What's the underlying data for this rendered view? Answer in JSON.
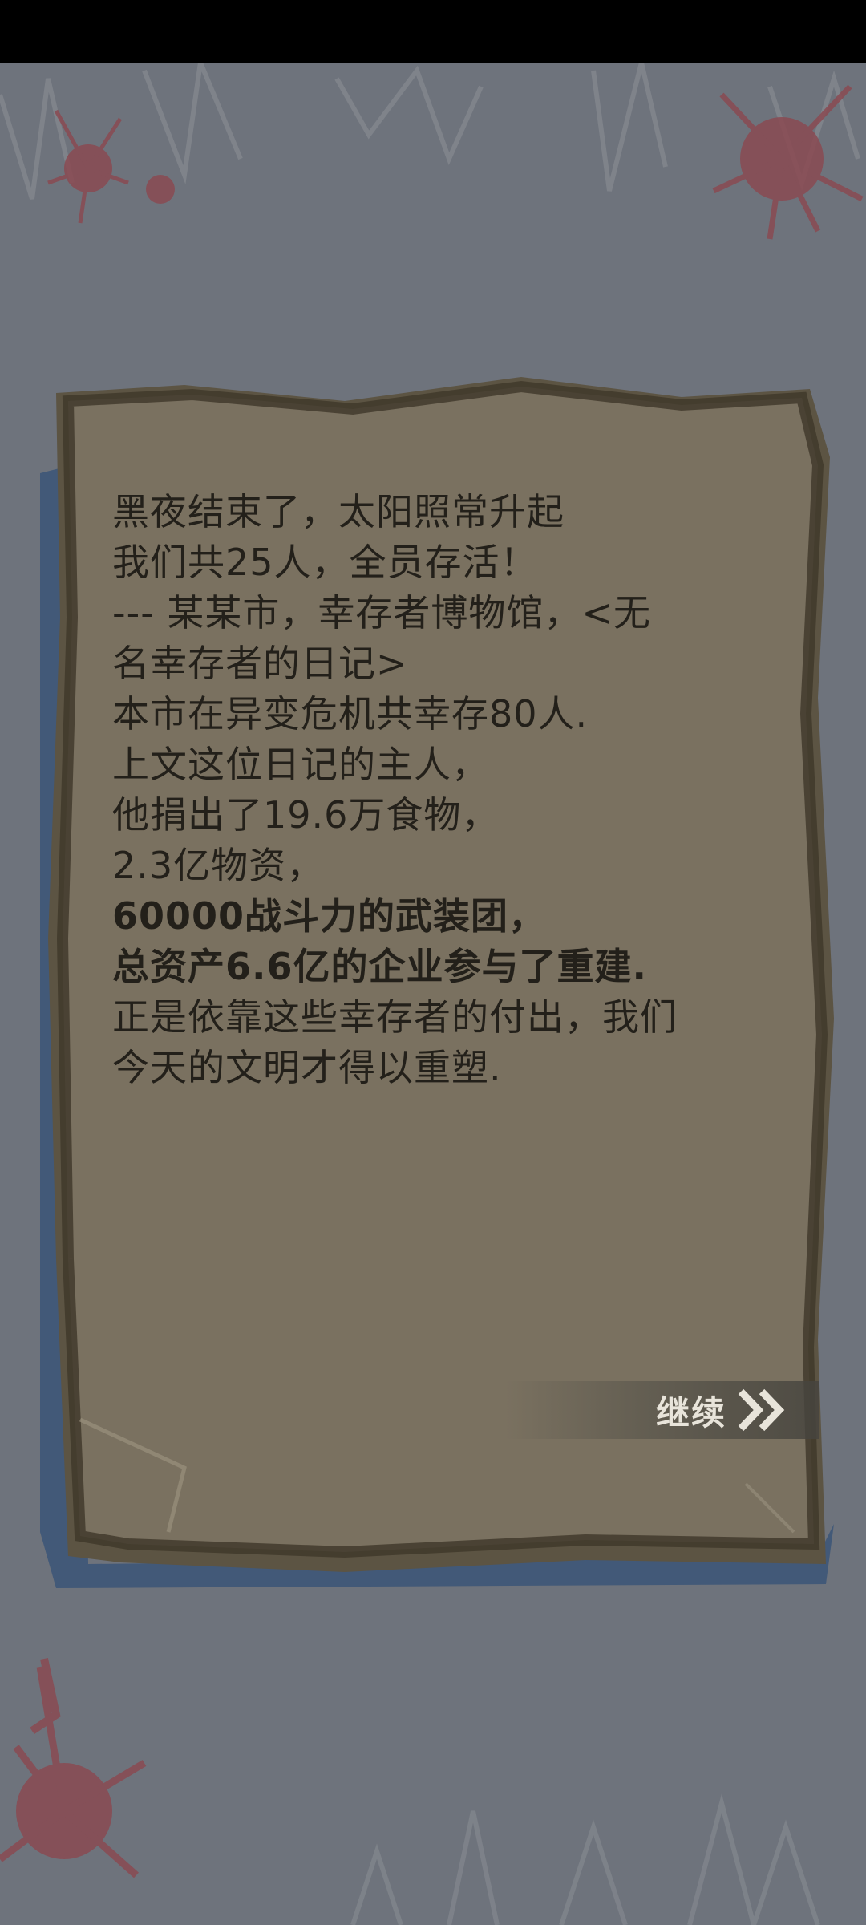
{
  "diary": {
    "lines": [
      {
        "text": "黑夜结束了，太阳照常升起"
      },
      {
        "text": "我们共25人，全员存活！"
      },
      {
        "text": "--- 某某市，幸存者博物馆，<无"
      },
      {
        "text": "名幸存者的日记>"
      },
      {
        "text": "本市在异变危机共幸存80人."
      },
      {
        "text": "上文这位日记的主人，"
      },
      {
        "text": "他捐出了19.6万食物，"
      },
      {
        "text": "2.3亿物资，"
      },
      {
        "text": "60000战斗力的武装团，"
      },
      {
        "text": "总资产6.6亿的企业参与了重建."
      },
      {
        "text": "正是依靠这些幸存者的付出，我们"
      },
      {
        "text": "今天的文明才得以重塑."
      }
    ]
  },
  "continue_button": {
    "label": "继续",
    "icon": "double-chevron-right-icon"
  },
  "colors": {
    "backdrop": "#6e737c",
    "paper": "#7a7160",
    "paper_edge": "#4e4636",
    "blue_underlay": "#3d5778",
    "text": "#23201a",
    "blood": "#8a4a52"
  }
}
